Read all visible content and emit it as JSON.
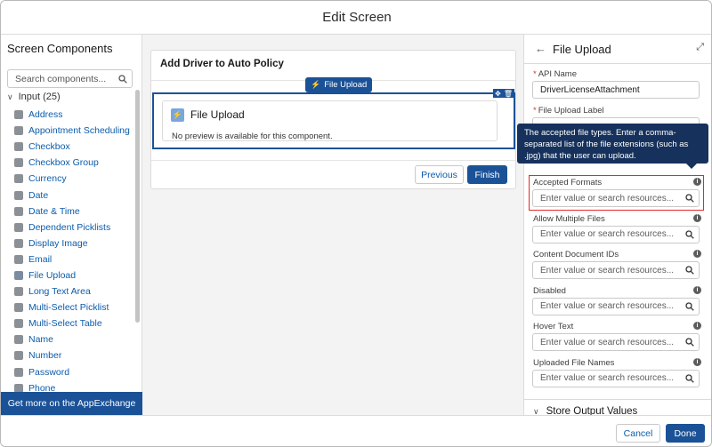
{
  "header": {
    "title": "Edit Screen"
  },
  "left_panel": {
    "title": "Screen Components",
    "search_placeholder": "Search components...",
    "group_label": "Input (25)",
    "items": [
      {
        "label": "Address",
        "icon": "address-icon"
      },
      {
        "label": "Appointment Scheduling",
        "icon": "calendar-icon"
      },
      {
        "label": "Checkbox",
        "icon": "checkbox-icon"
      },
      {
        "label": "Checkbox Group",
        "icon": "checkbox-group-icon"
      },
      {
        "label": "Currency",
        "icon": "currency-icon"
      },
      {
        "label": "Date",
        "icon": "date-icon"
      },
      {
        "label": "Date & Time",
        "icon": "datetime-icon"
      },
      {
        "label": "Dependent Picklists",
        "icon": "picklist-icon"
      },
      {
        "label": "Display Image",
        "icon": "image-icon"
      },
      {
        "label": "Email",
        "icon": "email-icon"
      },
      {
        "label": "File Upload",
        "icon": "bolt-icon"
      },
      {
        "label": "Long Text Area",
        "icon": "textarea-icon"
      },
      {
        "label": "Multi-Select Picklist",
        "icon": "multiselect-icon"
      },
      {
        "label": "Multi-Select Table",
        "icon": "table-icon"
      },
      {
        "label": "Name",
        "icon": "name-icon"
      },
      {
        "label": "Number",
        "icon": "number-icon"
      },
      {
        "label": "Password",
        "icon": "password-icon"
      },
      {
        "label": "Phone",
        "icon": "phone-icon"
      }
    ],
    "appexchange_label": "Get more on the AppExchange"
  },
  "canvas": {
    "screen_title": "Add Driver to Auto Policy",
    "component_tag": "File Upload",
    "component_title": "File Upload",
    "component_message": "No preview is available for this component.",
    "previous_label": "Previous",
    "finish_label": "Finish"
  },
  "right_panel": {
    "title": "File Upload",
    "api_name_label": "API Name",
    "api_name_value": "DriverLicenseAttachment",
    "file_upload_label_label": "File Upload Label",
    "tooltip": "The accepted file types. Enter a comma-separated list of the file extensions (such as .jpg) that the user can upload.",
    "fields": [
      {
        "label": "Accepted Formats",
        "placeholder": "Enter value or search resources..."
      },
      {
        "label": "Allow Multiple Files",
        "placeholder": "Enter value or search resources..."
      },
      {
        "label": "Content Document IDs",
        "placeholder": "Enter value or search resources..."
      },
      {
        "label": "Disabled",
        "placeholder": "Enter value or search resources..."
      },
      {
        "label": "Hover Text",
        "placeholder": "Enter value or search resources..."
      },
      {
        "label": "Uploaded File Names",
        "placeholder": "Enter value or search resources..."
      }
    ],
    "store_output_label": "Store Output Values"
  },
  "footer": {
    "cancel_label": "Cancel",
    "done_label": "Done"
  },
  "colors": {
    "brand": "#1b5297",
    "link": "#0b5cab",
    "highlight": "#e12a2a",
    "tooltip_bg": "#16325c"
  }
}
